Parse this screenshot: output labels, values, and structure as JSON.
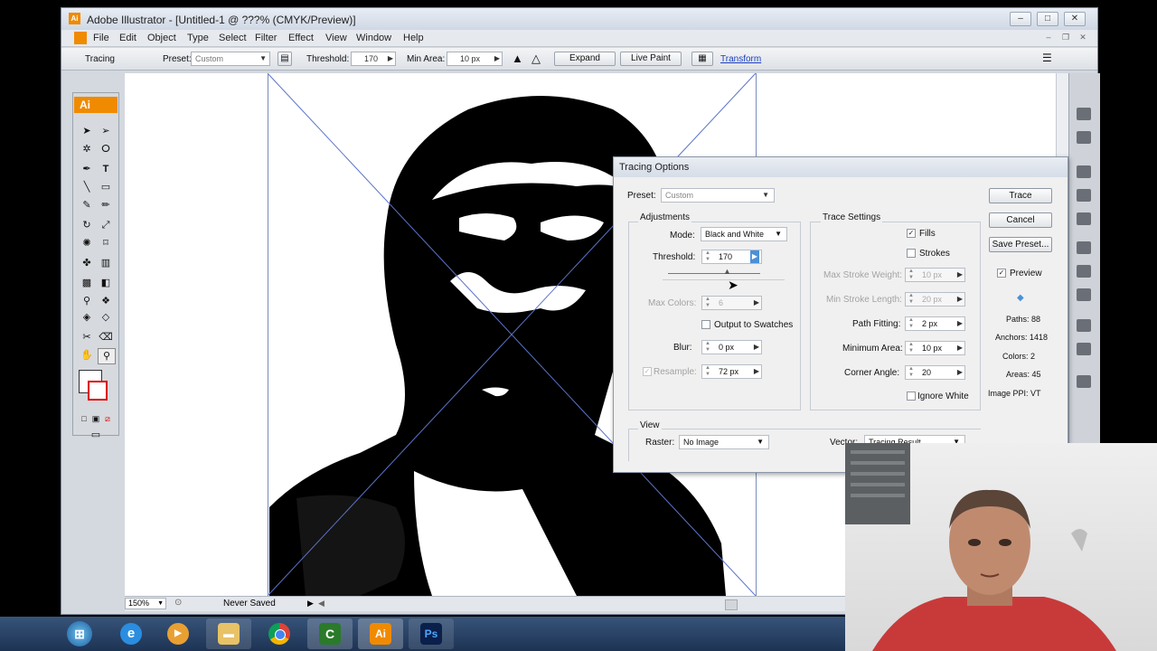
{
  "window": {
    "title": "Adobe Illustrator - [Untitled-1 @ ???% (CMYK/Preview)]",
    "controls": [
      "–",
      "□",
      "✕"
    ]
  },
  "menu": [
    "File",
    "Edit",
    "Object",
    "Type",
    "Select",
    "Filter",
    "Effect",
    "View",
    "Window",
    "Help"
  ],
  "control_bar": {
    "tracing_label": "Tracing",
    "preset_label": "Preset:",
    "preset_value": "Custom",
    "threshold_label": "Threshold:",
    "threshold_value": "170",
    "min_area_label": "Min Area:",
    "min_area_value": "10 px",
    "expand_label": "Expand",
    "live_paint_label": "Live Paint",
    "transform_label": "Transform"
  },
  "tools_panel": {
    "logo": "Ai"
  },
  "status_bar": {
    "zoom": "150%",
    "save_status": "Never Saved"
  },
  "dialog": {
    "title": "Tracing Options",
    "preset_label": "Preset:",
    "preset_value": "Custom",
    "adjustments": {
      "title": "Adjustments",
      "mode_label": "Mode:",
      "mode_value": "Black and White",
      "threshold_label": "Threshold:",
      "threshold_value": "170",
      "max_colors_label": "Max Colors:",
      "max_colors_value": "6",
      "output_swatches_label": "Output to Swatches",
      "blur_label": "Blur:",
      "blur_value": "0 px",
      "resample_label": "Resample:",
      "resample_value": "72 px"
    },
    "trace_settings": {
      "title": "Trace Settings",
      "fills_label": "Fills",
      "strokes_label": "Strokes",
      "max_stroke_weight_label": "Max Stroke Weight:",
      "max_stroke_weight_value": "10 px",
      "min_stroke_length_label": "Min Stroke Length:",
      "min_stroke_length_value": "20 px",
      "path_fitting_label": "Path Fitting:",
      "path_fitting_value": "2 px",
      "minimum_area_label": "Minimum Area:",
      "minimum_area_value": "10 px",
      "corner_angle_label": "Corner Angle:",
      "corner_angle_value": "20",
      "ignore_white_label": "Ignore White"
    },
    "view": {
      "title": "View",
      "raster_label": "Raster:",
      "raster_value": "No Image",
      "vector_label": "Vector:",
      "vector_value": "Tracing Result"
    },
    "buttons": {
      "trace": "Trace",
      "cancel": "Cancel",
      "save_preset": "Save Preset..."
    },
    "preview_label": "Preview",
    "stats": {
      "paths": "Paths: 88",
      "anchors": "Anchors: 1418",
      "colors": "Colors: 2",
      "areas": "Areas: 45",
      "image_ppi": "Image PPI: VT"
    }
  },
  "taskbar": {
    "items": [
      "start-orb",
      "internet-explorer",
      "media-player",
      "file-explorer",
      "chrome",
      "camtasia",
      "illustrator",
      "photoshop"
    ],
    "illustrator_label": "Ai",
    "photoshop_label": "Ps"
  },
  "colors": {
    "illustrator_orange": "#f08a00",
    "photoshop_blue": "#0a1f4a",
    "taskbar": "#1d3354"
  }
}
